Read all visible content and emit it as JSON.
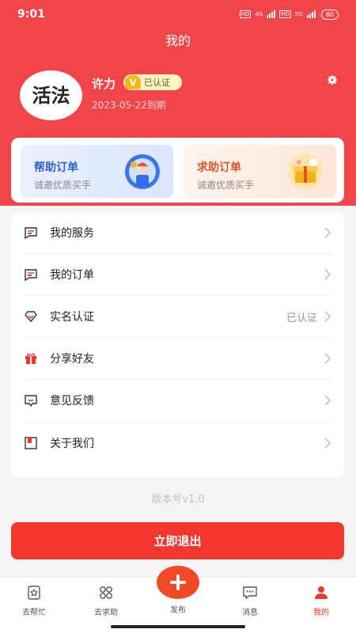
{
  "status_bar": {
    "time": "9:01",
    "hd1": "HD",
    "net1": "4G",
    "hd2": "HD",
    "net2": "5G",
    "battery": "80"
  },
  "header": {
    "title": "我的"
  },
  "profile": {
    "avatar_text": "活法",
    "name": "许力",
    "verified_mark": "V",
    "verified_label": "已认证",
    "expire_date": "2023-05-22到期"
  },
  "order_cards": [
    {
      "title": "帮助订单",
      "subtitle": "诚邀优质买手"
    },
    {
      "title": "求助订单",
      "subtitle": "诚邀优质买手"
    }
  ],
  "menu": [
    {
      "label": "我的服务",
      "icon": "message-square-icon"
    },
    {
      "label": "我的订单",
      "icon": "order-list-icon"
    },
    {
      "label": "实名认证",
      "icon": "diamond-icon",
      "status": "已认证"
    },
    {
      "label": "分享好友",
      "icon": "gift-icon"
    },
    {
      "label": "意见反馈",
      "icon": "chat-bubble-icon"
    },
    {
      "label": "关于我们",
      "icon": "book-icon"
    }
  ],
  "version": "版本号v1.0",
  "logout_label": "立即退出",
  "tabs": [
    {
      "label": "去帮忙",
      "icon": "help-star-icon"
    },
    {
      "label": "去求助",
      "icon": "grid-circles-icon"
    },
    {
      "label": "发布",
      "icon": "plus-icon"
    },
    {
      "label": "消息",
      "icon": "message-dots-icon"
    },
    {
      "label": "我的",
      "icon": "person-icon",
      "active": true
    }
  ],
  "colors": {
    "primary_red": "#f2454a",
    "button_red": "#f2372f",
    "help_blue": "#2f5fd6",
    "seek_orange": "#e0542a",
    "badge_gold": "#f4b81d"
  }
}
